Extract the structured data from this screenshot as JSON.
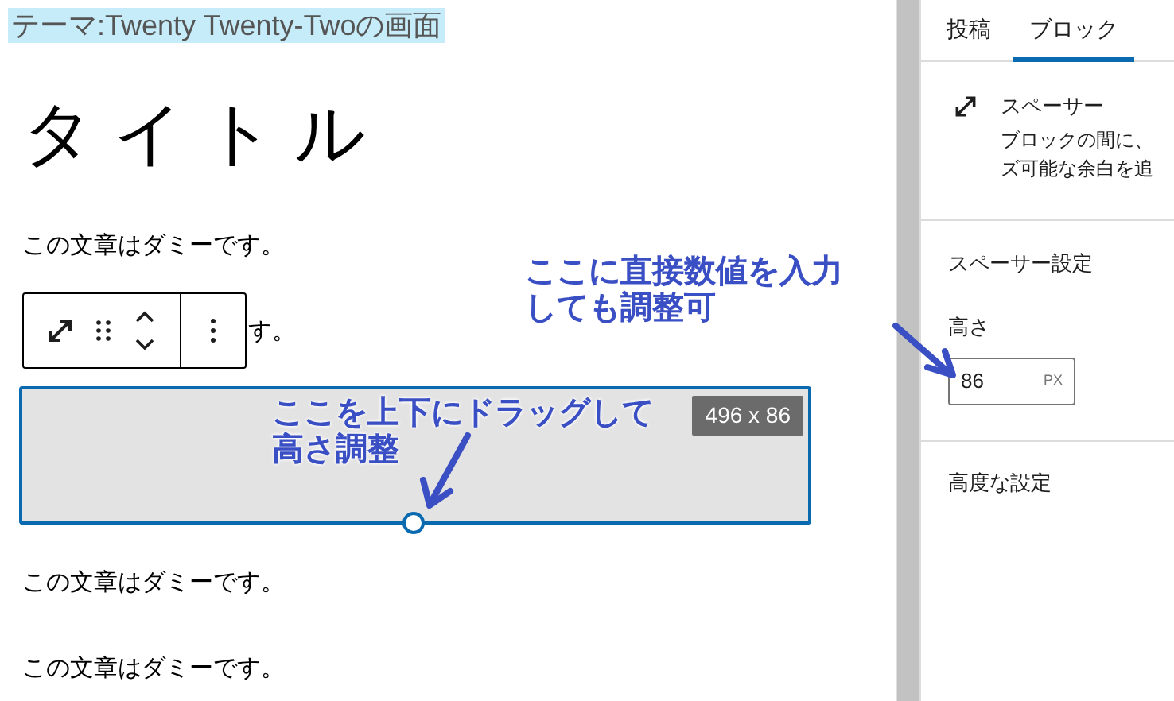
{
  "editor": {
    "theme_label": "テーマ:Twenty Twenty-Twoの画面",
    "title": "タイトル",
    "paragraph_first": "この文章はダミーです。",
    "paragraph_second_visible_part": "す。",
    "spacer": {
      "size_badge": "496 x 86",
      "selected": true
    },
    "paragraphs_after": [
      "この文章はダミーです。",
      "この文章はダミーです。"
    ]
  },
  "sidebar": {
    "tabs": [
      {
        "label": "投稿",
        "selected": false
      },
      {
        "label": "ブロック",
        "selected": true
      }
    ],
    "block_card": {
      "name": "スペーサー",
      "description_lines": [
        "ブロックの間に、",
        "ズ可能な余白を追"
      ]
    },
    "settings_title": "スペーサー設定",
    "height_label": "高さ",
    "height_value": "86",
    "height_unit": "PX",
    "advanced": "高度な設定"
  },
  "annotations": [
    {
      "text_lines": [
        "ここに直接数値を入力",
        "しても調整可"
      ]
    },
    {
      "text_lines": [
        "ここを上下にドラッグして",
        "高さ調整"
      ]
    }
  ]
}
